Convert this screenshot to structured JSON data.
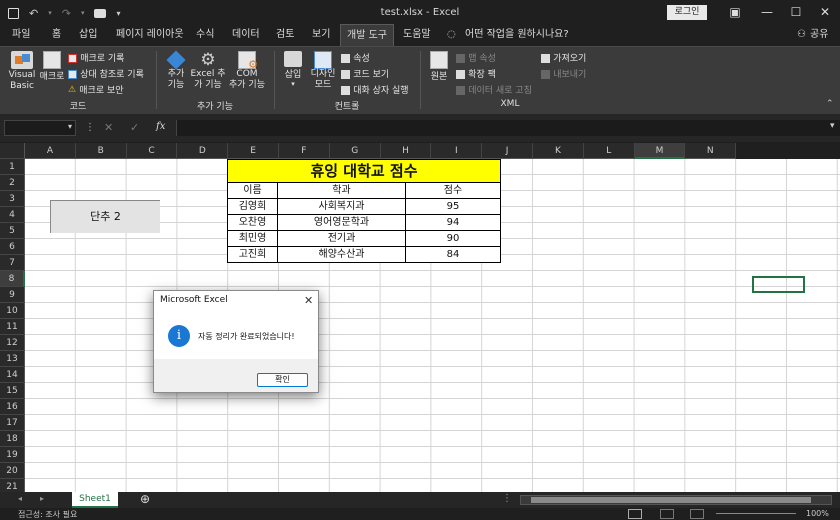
{
  "titlebar": {
    "title": "test.xlsx  -  Excel",
    "login": "로그인",
    "undo_icon": "undo-icon",
    "redo_icon": "redo-icon"
  },
  "tabs": [
    "파일",
    "홈",
    "삽입",
    "페이지 레이아웃",
    "수식",
    "데이터",
    "검토",
    "보기",
    "개발 도구",
    "도움말"
  ],
  "active_tab": "개발 도구",
  "tellme": "어떤 작업을 원하시나요?",
  "share": "공유",
  "ribbon": {
    "code": {
      "visual_basic": "Visual\nBasic",
      "macro": "매크로",
      "record": "매크로 기록",
      "relative": "상대 참조로 기록",
      "security": "매크로 보안",
      "label": "코드"
    },
    "addins": {
      "addin": "추가\n기능",
      "excel_addin": "Excel 추\n가 기능",
      "com_addin": "COM\n추가 기능",
      "label": "추가 기능"
    },
    "controls": {
      "insert": "삽입",
      "design": "디자인\n모드",
      "properties": "속성",
      "view_code": "코드 보기",
      "dialog": "대화 상자 실행",
      "label": "컨트롤"
    },
    "xml": {
      "source": "원본",
      "map_props": "맵 속성",
      "expansion": "확장 팩",
      "refresh": "데이터 새로 고침",
      "import": "가져오기",
      "export": "내보내기",
      "label": "XML"
    }
  },
  "formula": {
    "name_box": "",
    "fx": "fx"
  },
  "columns": [
    "A",
    "B",
    "C",
    "D",
    "E",
    "F",
    "G",
    "H",
    "I",
    "J",
    "K",
    "L",
    "M",
    "N"
  ],
  "rows": [
    "1",
    "2",
    "3",
    "4",
    "5",
    "6",
    "7",
    "8",
    "9",
    "10",
    "11",
    "12",
    "13",
    "14",
    "15",
    "16",
    "17",
    "18",
    "19",
    "20",
    "21"
  ],
  "sheet_title": "휴잉 대학교 점수",
  "table_header": [
    "이름",
    "학과",
    "점수"
  ],
  "table_rows": [
    [
      "김영희",
      "사회복지과",
      "95"
    ],
    [
      "오찬영",
      "영어영문학과",
      "94"
    ],
    [
      "최민영",
      "전기과",
      "90"
    ],
    [
      "고진희",
      "해양수산과",
      "84"
    ]
  ],
  "button_label": "단추 2",
  "sheet_tab": "Sheet1",
  "status": "접근성: 조사 필요",
  "zoom": "100%",
  "dialog": {
    "title": "Microsoft Excel",
    "message": "자동 정리가 완료되었습니다!",
    "ok": "확인"
  },
  "colors": {
    "title_fill": "#ffff00",
    "selected": "#217346",
    "dialog_icon": "#1a78d4"
  }
}
